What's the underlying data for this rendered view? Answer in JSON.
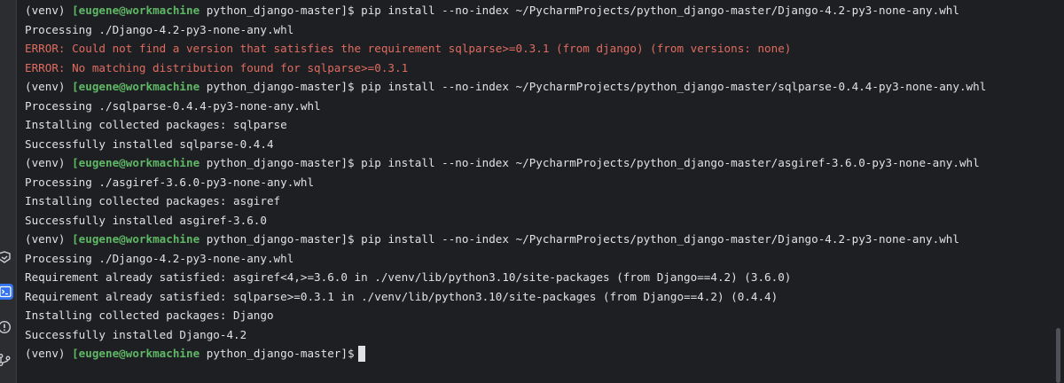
{
  "prompt": {
    "venv": "(venv)",
    "user": "[eugene@workmachine",
    "dir": " python_django-master]",
    "symbol": "$"
  },
  "lines": [
    {
      "type": "cmd",
      "text": "pip install --no-index ~/PycharmProjects/python_django-master/Django-4.2-py3-none-any.whl"
    },
    {
      "type": "out",
      "text": "Processing ./Django-4.2-py3-none-any.whl"
    },
    {
      "type": "err",
      "text": "ERROR: Could not find a version that satisfies the requirement sqlparse>=0.3.1 (from django) (from versions: none)"
    },
    {
      "type": "err",
      "text": "ERROR: No matching distribution found for sqlparse>=0.3.1"
    },
    {
      "type": "cmd",
      "text": "pip install --no-index ~/PycharmProjects/python_django-master/sqlparse-0.4.4-py3-none-any.whl"
    },
    {
      "type": "out",
      "text": "Processing ./sqlparse-0.4.4-py3-none-any.whl"
    },
    {
      "type": "out",
      "text": "Installing collected packages: sqlparse"
    },
    {
      "type": "out",
      "text": "Successfully installed sqlparse-0.4.4"
    },
    {
      "type": "cmd",
      "text": "pip install --no-index ~/PycharmProjects/python_django-master/asgiref-3.6.0-py3-none-any.whl"
    },
    {
      "type": "out",
      "text": "Processing ./asgiref-3.6.0-py3-none-any.whl"
    },
    {
      "type": "out",
      "text": "Installing collected packages: asgiref"
    },
    {
      "type": "out",
      "text": "Successfully installed asgiref-3.6.0"
    },
    {
      "type": "cmd",
      "text": "pip install --no-index ~/PycharmProjects/python_django-master/Django-4.2-py3-none-any.whl"
    },
    {
      "type": "out",
      "text": "Processing ./Django-4.2-py3-none-any.whl"
    },
    {
      "type": "out",
      "text": "Requirement already satisfied: asgiref<4,>=3.6.0 in ./venv/lib/python3.10/site-packages (from Django==4.2) (3.6.0)"
    },
    {
      "type": "out",
      "text": "Requirement already satisfied: sqlparse>=0.3.1 in ./venv/lib/python3.10/site-packages (from Django==4.2) (0.4.4)"
    },
    {
      "type": "out",
      "text": "Installing collected packages: Django"
    },
    {
      "type": "out",
      "text": "Successfully installed Django-4.2"
    },
    {
      "type": "cmd",
      "text": ""
    }
  ],
  "sidebar_icons": [
    "services-icon",
    "terminal-icon",
    "problems-icon",
    "git-icon"
  ],
  "colors": {
    "background": "#1e1f22",
    "text": "#dfe1e5",
    "user": "#5fb865",
    "error": "#e06c60",
    "accent": "#3574f0"
  }
}
